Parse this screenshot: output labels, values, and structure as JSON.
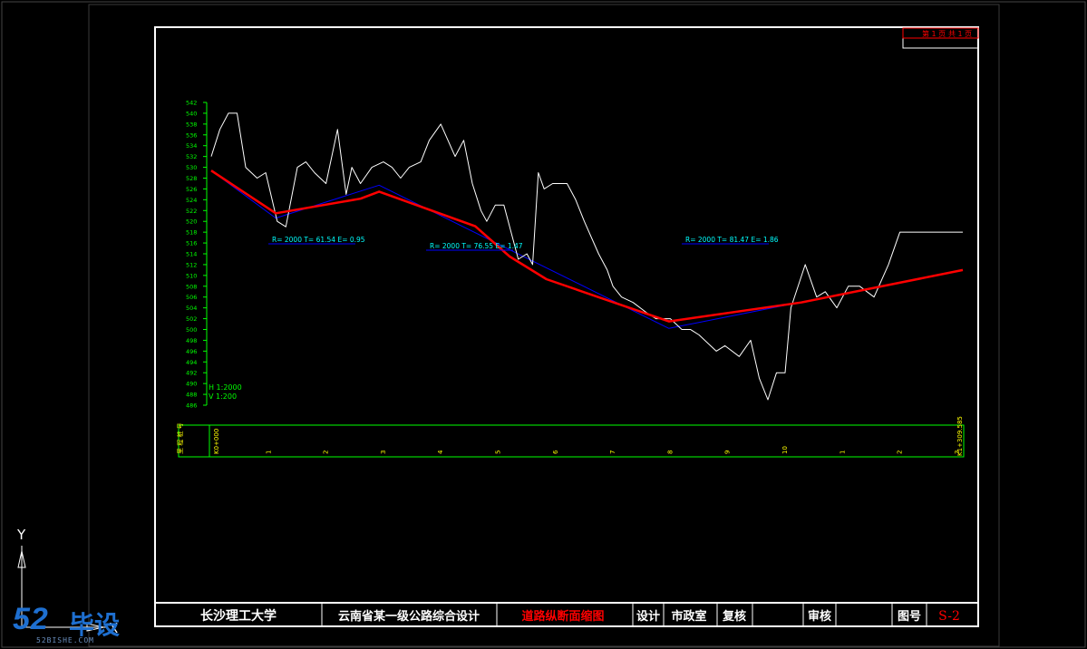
{
  "sheet": {
    "page_label_1": "第 1 页",
    "page_label_2": "共 1 页"
  },
  "title_block": {
    "university": "长沙理工大学",
    "project": "云南省某一级公路综合设计",
    "drawing_title": "道路纵断面缩图",
    "design_label": "设计",
    "design_dept": "市政室",
    "review_label": "复核",
    "approve_label": "审核",
    "drawing_no_label": "图号",
    "drawing_no": "S-2"
  },
  "profile": {
    "scale_h": "H 1:2000",
    "scale_v": "V 1:200",
    "band_label": "里 程 桩 号",
    "station_start": "K0+000",
    "station_end": "K1+309.585",
    "station_ticks": [
      "1",
      "2",
      "3",
      "4",
      "5",
      "6",
      "7",
      "8",
      "9",
      "10",
      "1",
      "2",
      "3"
    ],
    "curve_labels": [
      "R= 2000  T= 61.54  E= 0.95",
      "R= 2000  T= 76.55  E= 1.47",
      "R= 2000  T= 81.47  E= 1.86"
    ],
    "colors": {
      "ground": "#ffffff",
      "grade": "#ff0000",
      "tangent": "#0000ff",
      "axis": "#00ff00",
      "frame": "#ffffff",
      "label_yellow": "#ffff00",
      "title_red": "#ff0000"
    }
  },
  "chart_data": {
    "type": "line",
    "title": "",
    "xlabel": "",
    "ylabel": "",
    "xlim": [
      0,
      1309.585
    ],
    "ylim": [
      486,
      542
    ],
    "yticks": [
      486,
      488,
      490,
      492,
      494,
      496,
      498,
      500,
      502,
      504,
      506,
      508,
      510,
      512,
      514,
      516,
      518,
      520,
      522,
      524,
      526,
      528,
      530,
      532,
      534,
      536,
      538,
      540,
      542
    ],
    "series": [
      {
        "x": [
          0,
          15,
          30,
          45,
          60,
          80,
          95,
          115,
          130,
          150,
          165,
          180,
          200,
          220,
          235,
          245,
          260,
          280,
          300,
          315,
          330,
          345,
          365,
          380,
          400,
          425,
          440,
          455,
          470,
          480,
          495,
          510,
          535,
          550,
          560,
          570,
          580,
          595,
          620,
          635,
          650,
          675,
          690,
          700,
          715,
          735,
          760,
          775,
          800,
          820,
          835,
          850,
          870,
          880,
          895,
          920,
          940,
          955,
          970,
          985,
          1000,
          1010,
          1035,
          1055,
          1070,
          1090,
          1110,
          1130,
          1155,
          1180,
          1200,
          1230,
          1250,
          1270,
          1290,
          1309.585
        ],
        "y": [
          532,
          537,
          540,
          540,
          530,
          528,
          529,
          520,
          519,
          530,
          531,
          529,
          527,
          537,
          525,
          530,
          527,
          530,
          531,
          530,
          528,
          530,
          531,
          535,
          538,
          532,
          535,
          527,
          522,
          520,
          523,
          523,
          513,
          514,
          512,
          529,
          526,
          527,
          527,
          524,
          520,
          514,
          511,
          508,
          506,
          505,
          503,
          502,
          502,
          500,
          500,
          499,
          497,
          496,
          497,
          495,
          498,
          491,
          487,
          492,
          492,
          504,
          512,
          506,
          507,
          504,
          508,
          508,
          506,
          512,
          518,
          518,
          518,
          518,
          518,
          518
        ]
      },
      {
        "x": [
          0,
          112.5,
          260,
          292.5,
          460,
          520,
          584,
          797.5,
          1028,
          1309.585
        ],
        "y": [
          529.4,
          521.5,
          524.2,
          525.5,
          519.1,
          513.5,
          509.3,
          501.5,
          505.0,
          511.0
        ]
      },
      {
        "x": [
          0,
          112.5,
          292.5,
          797.5,
          1309.585
        ],
        "y": [
          529.4,
          520.6,
          526.7,
          500.2,
          511.0
        ]
      }
    ]
  }
}
